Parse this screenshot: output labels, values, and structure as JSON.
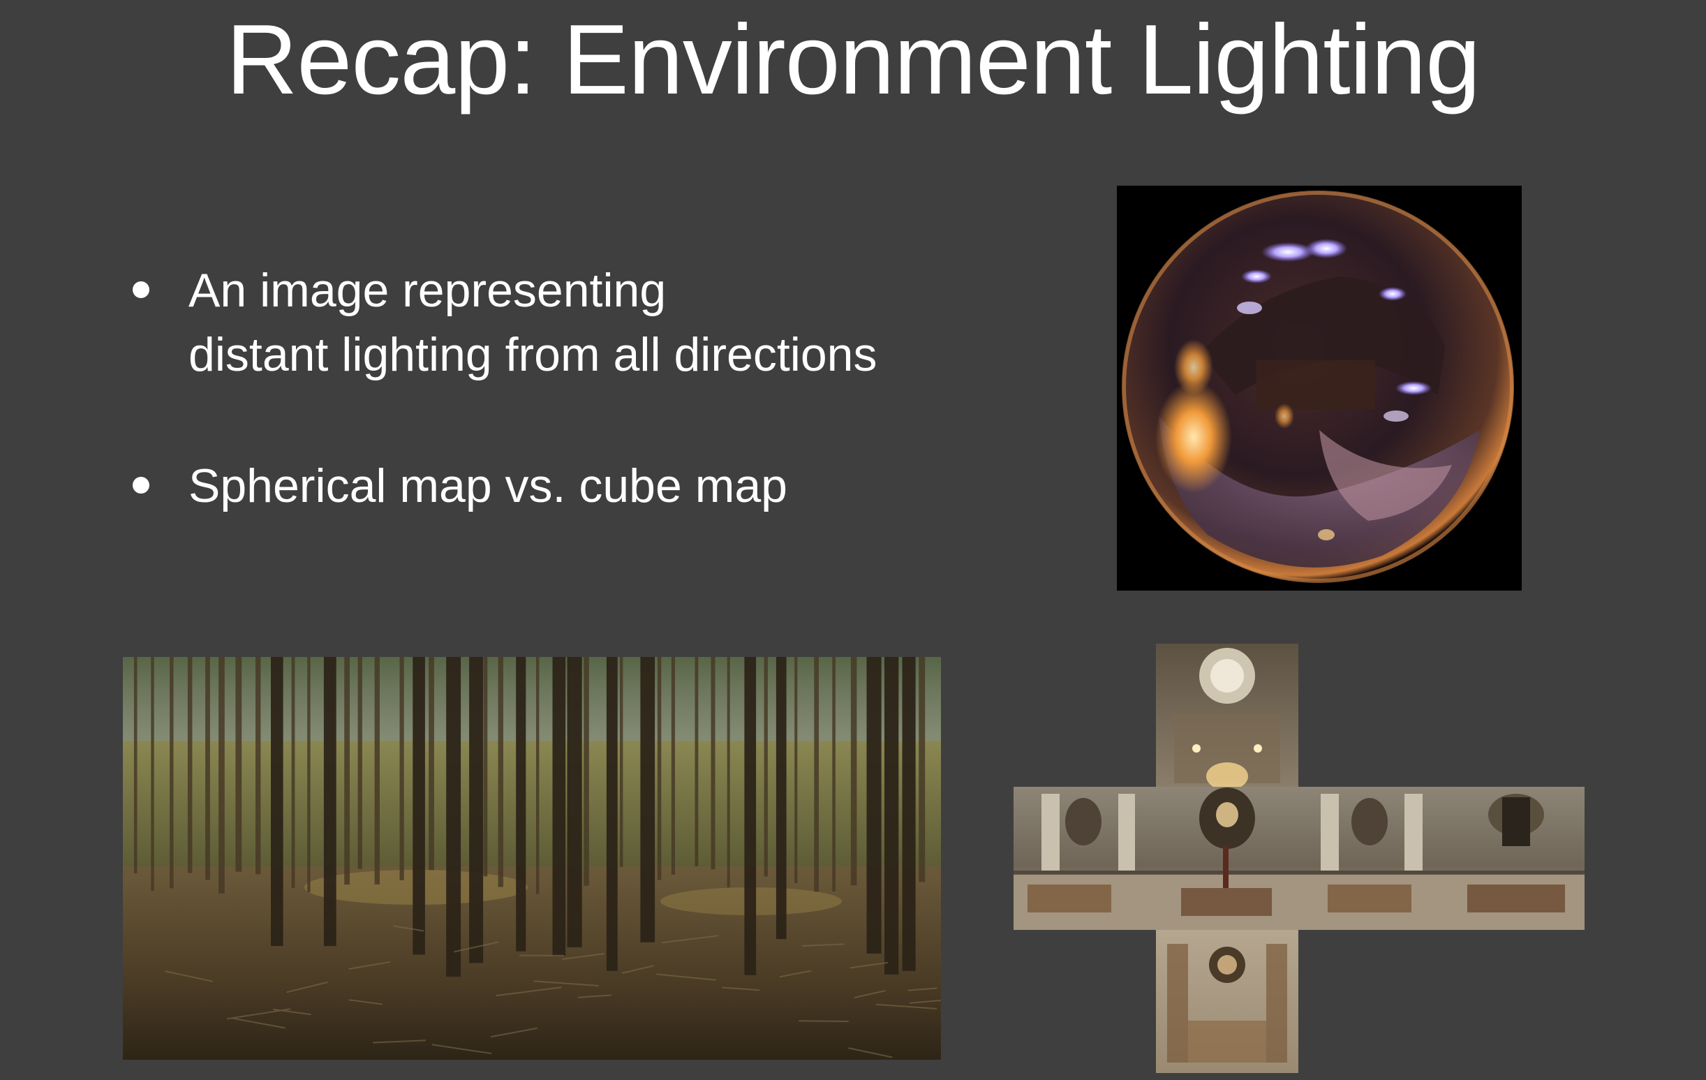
{
  "slide": {
    "title": "Recap: Environment Lighting",
    "bullets": [
      {
        "lines": [
          "An image representing",
          "distant lighting from all directions"
        ]
      },
      {
        "lines": [
          "Spherical map vs. cube map"
        ]
      }
    ]
  },
  "images": {
    "light_probe": "light-probe-sphere",
    "panorama": "forest-equirectangular-panorama",
    "cube_map": "cathedral-cube-map-cross"
  },
  "colors": {
    "background": "#3f3f3f",
    "text": "#ffffff"
  }
}
